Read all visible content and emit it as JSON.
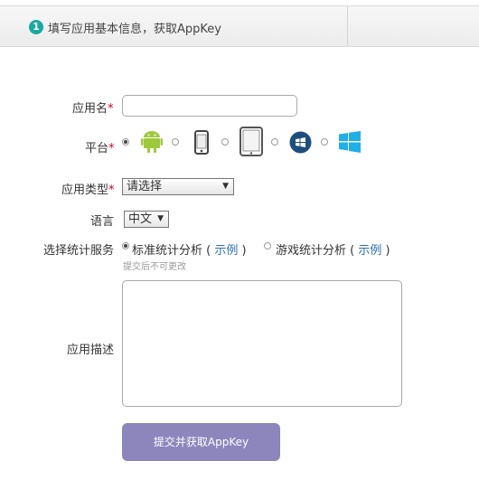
{
  "header": {
    "step_number": "1",
    "title": "填写应用基本信息，获取AppKey"
  },
  "form": {
    "app_name_label": "应用名",
    "platform_label": "平台",
    "required_mark": "*",
    "platforms": [
      {
        "name": "android",
        "selected": true
      },
      {
        "name": "iphone",
        "selected": false
      },
      {
        "name": "ipad",
        "selected": false
      },
      {
        "name": "windows-phone",
        "selected": false
      },
      {
        "name": "windows",
        "selected": false
      }
    ],
    "app_type_label": "应用类型",
    "app_type_value": "请选择",
    "language_label": "语言",
    "language_value": "中文",
    "stats_label": "选择统计服务",
    "stats_option_standard": "标准统计分析",
    "stats_option_game": "游戏统计分析",
    "paren_open": "(",
    "paren_close": ")",
    "example_link": "示例",
    "stats_hint": "提交后不可更改",
    "description_label": "应用描述",
    "submit_label": "提交并获取AppKey"
  },
  "colors": {
    "accent": "#1aa8a0",
    "submit": "#8c86bc",
    "android": "#9fc93c",
    "windows_phone": "#1d4e7e",
    "windows": "#1fb0e8",
    "link": "#2a6ebb"
  }
}
